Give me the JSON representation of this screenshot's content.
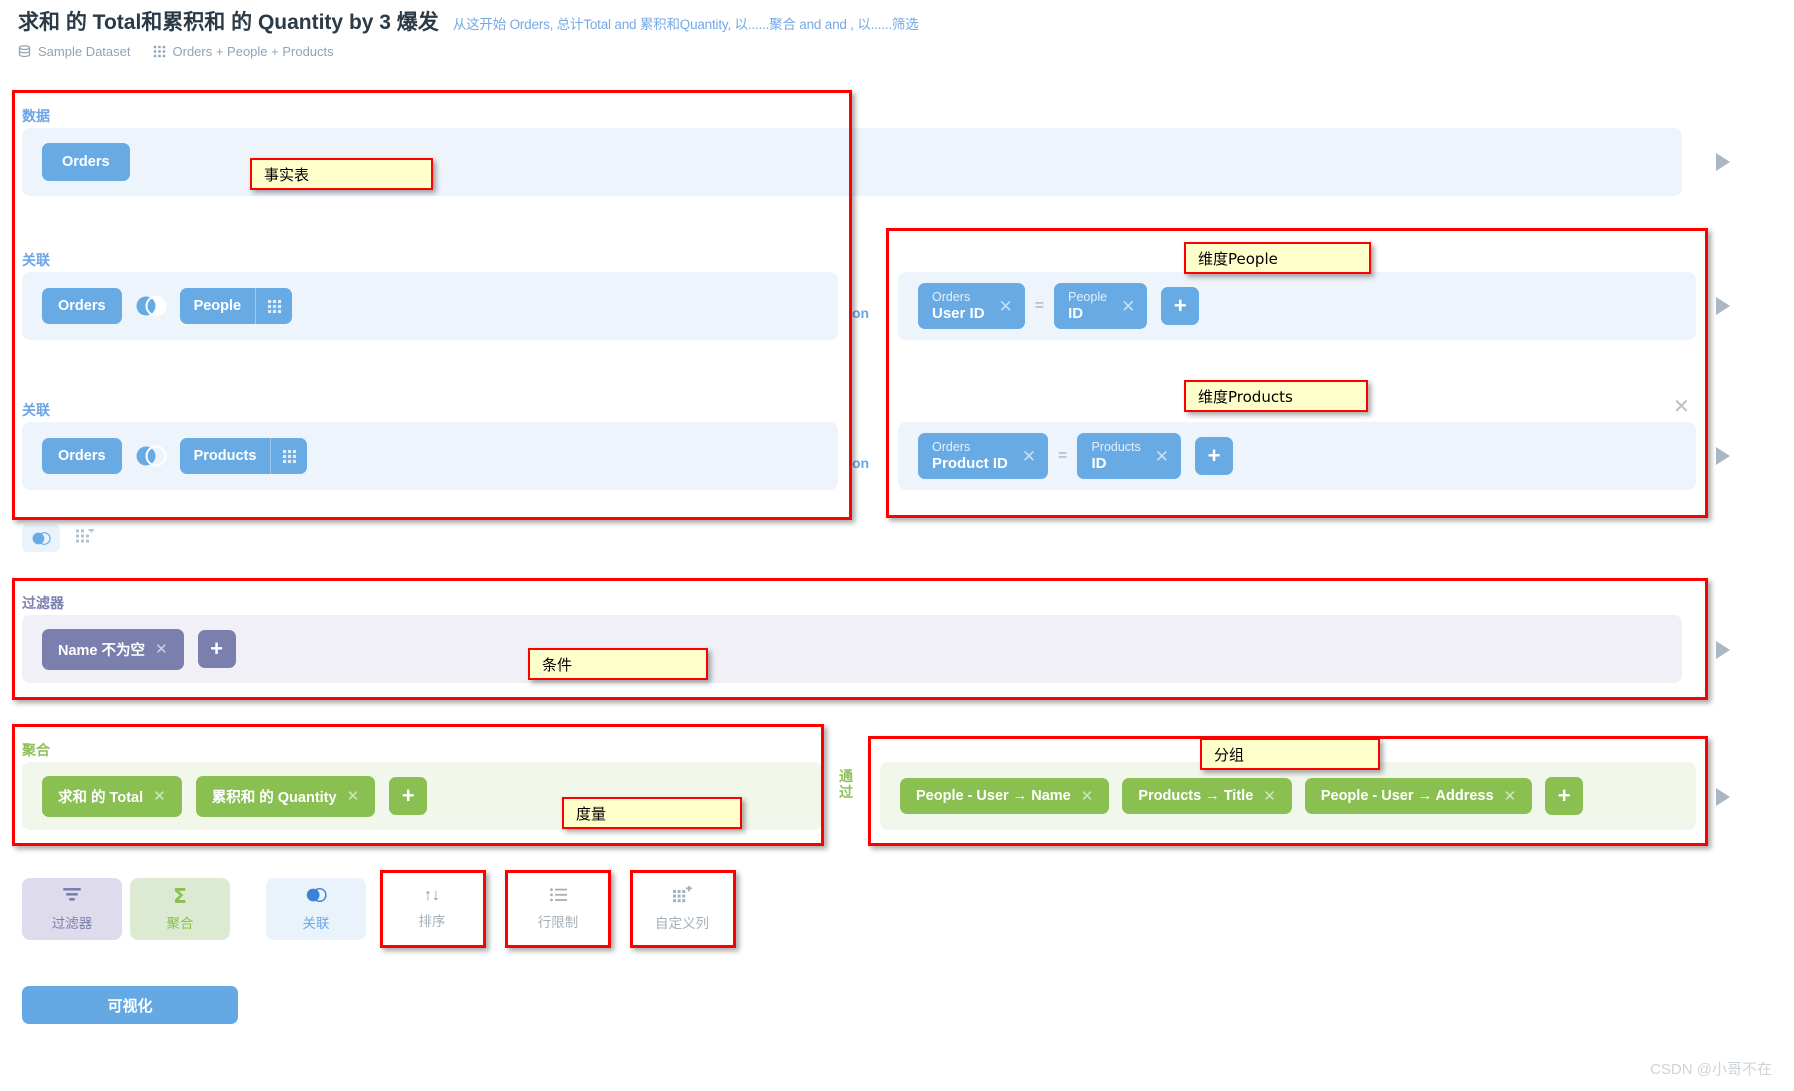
{
  "header": {
    "title": "求和 的 Total和累积和 的 Quantity by 3 爆发",
    "subtitle": "从这开始 Orders, 总计Total and 累积和Quantity, 以......聚合 and and , 以......筛选",
    "dataset_label": "Sample Dataset",
    "tables_label": "Orders + People + Products"
  },
  "steps": {
    "data": {
      "label": "数据",
      "source": "Orders"
    },
    "join_people": {
      "label": "关联",
      "left": "Orders",
      "right": "People",
      "on": "on",
      "cond_left_table": "Orders",
      "cond_left_field": "User ID",
      "operator": "=",
      "cond_right_table": "People",
      "cond_right_field": "ID",
      "add": "+"
    },
    "join_products": {
      "label": "关联",
      "left": "Orders",
      "right": "Products",
      "on": "on",
      "cond_left_table": "Orders",
      "cond_left_field": "Product ID",
      "operator": "=",
      "cond_right_table": "Products",
      "cond_right_field": "ID",
      "add": "+"
    },
    "filter": {
      "label": "过滤器",
      "pills": [
        "Name 不为空"
      ],
      "add": "+"
    },
    "summarize": {
      "label": "聚合",
      "by_label": "通过",
      "metrics": [
        "求和 的 Total",
        "累积和 的 Quantity"
      ],
      "add": "+",
      "breakouts": [
        "People - User → Name",
        "Products → Title",
        "People - User → Address"
      ],
      "breakout_add": "+"
    }
  },
  "notes": {
    "fact_table": "事实表",
    "dim_people": "维度People",
    "dim_products": "维度Products",
    "condition": "条件",
    "measure": "度量",
    "grouping": "分组"
  },
  "actions": [
    {
      "label": "过滤器",
      "icon": "filter-icon"
    },
    {
      "label": "聚合",
      "icon": "sigma-icon"
    },
    {
      "label": "关联",
      "icon": "join-icon"
    },
    {
      "label": "排序",
      "icon": "sort-icon"
    },
    {
      "label": "行限制",
      "icon": "row-limit-icon"
    },
    {
      "label": "自定义列",
      "icon": "custom-column-icon"
    }
  ],
  "visualize_button": "可视化",
  "watermark": "CSDN @小哥不在",
  "colors": {
    "blue": "#68aae4",
    "purple": "#7b7fae",
    "green": "#8ac051",
    "annotation_red": "#ff0000",
    "note_yellow": "#ffffcc"
  }
}
